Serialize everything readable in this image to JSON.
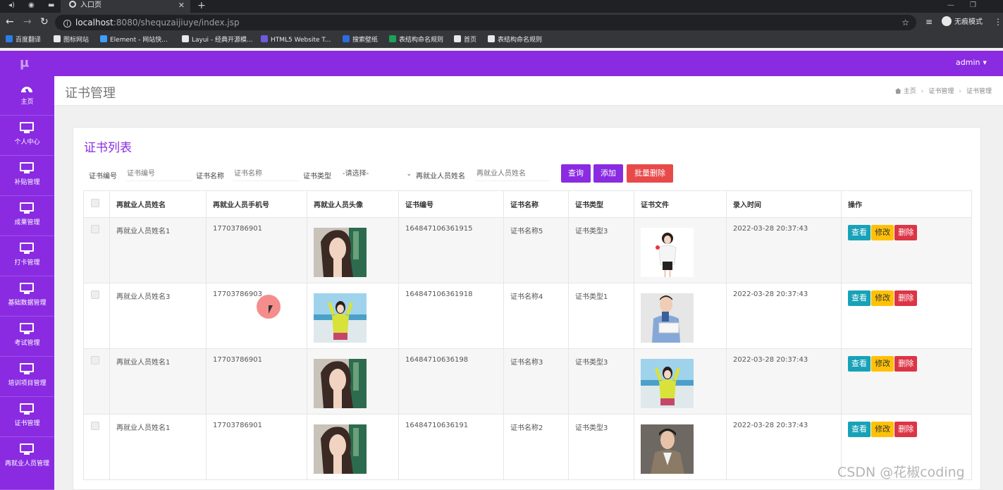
{
  "browser": {
    "tab_title": "入口页",
    "url_host": "localhost",
    "url_path": ":8080/shequzaijiuye/index.jsp",
    "incognito_label": "无痕模式",
    "bookmarks": [
      {
        "label": "百度翻译",
        "color": "#2b7de9"
      },
      {
        "label": "图标网站",
        "color": "#e8e8e8"
      },
      {
        "label": "Element - 网站快...",
        "color": "#409eff"
      },
      {
        "label": "Layui - 经典开源模...",
        "color": "#e8e8e8"
      },
      {
        "label": "HTML5 Website T...",
        "color": "#6b5be0"
      },
      {
        "label": "搜索壁纸",
        "color": "#2d6cdf"
      },
      {
        "label": "表结构命名规则",
        "color": "#1aa35a"
      },
      {
        "label": "首页",
        "color": "#e8e8e8"
      },
      {
        "label": "表结构命名规则",
        "color": "#e8e8e8"
      }
    ]
  },
  "header": {
    "logo": "μ",
    "user": "admin"
  },
  "sidebar": {
    "items": [
      {
        "label": "主页",
        "icon": "dashboard-icon"
      },
      {
        "label": "个人中心",
        "icon": "monitor-icon"
      },
      {
        "label": "补贴管理",
        "icon": "monitor-icon"
      },
      {
        "label": "成果管理",
        "icon": "monitor-icon"
      },
      {
        "label": "打卡管理",
        "icon": "monitor-icon"
      },
      {
        "label": "基础数据管理",
        "icon": "monitor-icon"
      },
      {
        "label": "考试管理",
        "icon": "monitor-icon"
      },
      {
        "label": "培训项目管理",
        "icon": "monitor-icon"
      },
      {
        "label": "证书管理",
        "icon": "monitor-icon"
      },
      {
        "label": "再就业人员管理",
        "icon": "monitor-icon"
      }
    ]
  },
  "page": {
    "title": "证书管理",
    "breadcrumb": [
      "主页",
      "证书管理",
      "证书管理"
    ]
  },
  "card": {
    "title": "证书列表"
  },
  "filters": {
    "cert_no_label": "证书编号",
    "cert_no_placeholder": "证书编号",
    "cert_name_label": "证书名称",
    "cert_name_placeholder": "证书名称",
    "cert_type_label": "证书类型",
    "cert_type_value": "-请选择-",
    "person_label": "再就业人员姓名",
    "person_placeholder": "再就业人员姓名"
  },
  "buttons": {
    "search": "查询",
    "add": "添加",
    "batch_delete": "批量删除",
    "search_color": "#8a2be2",
    "add_color": "#8a2be2",
    "batch_delete_color": "#e84a4a"
  },
  "table": {
    "headers": [
      "再就业人员姓名",
      "再就业人员手机号",
      "再就业人员头像",
      "证书编号",
      "证书名称",
      "证书类型",
      "证书文件",
      "录入时间",
      "操作"
    ],
    "actions": {
      "view": "查看",
      "edit": "修改",
      "delete": "删除"
    },
    "rows": [
      {
        "name": "再就业人员姓名1",
        "phone": "17703786901",
        "avatar": "portrait-woman-image",
        "cert_no": "164847106361915",
        "cert_name": "证书名称5",
        "cert_type": "证书类型3",
        "file": "woman-white-shirt-image",
        "time": "2022-03-28 20:37:43"
      },
      {
        "name": "再就业人员姓名3",
        "phone": "17703786903",
        "avatar": "yellow-sweater-woman-image",
        "cert_no": "164847106361918",
        "cert_name": "证书名称4",
        "cert_type": "证书类型1",
        "file": "man-reading-book-image",
        "time": "2022-03-28 20:37:43"
      },
      {
        "name": "再就业人员姓名1",
        "phone": "17703786901",
        "avatar": "portrait-woman-image",
        "cert_no": "16484710636198",
        "cert_name": "证书名称3",
        "cert_type": "证书类型3",
        "file": "yellow-sweater-woman-image",
        "time": "2022-03-28 20:37:43"
      },
      {
        "name": "再就业人员姓名1",
        "phone": "17703786901",
        "avatar": "portrait-woman-image",
        "cert_no": "16484710636191",
        "cert_name": "证书名称2",
        "cert_type": "证书类型3",
        "file": "man-coat-image",
        "time": "2022-03-28 20:37:43"
      }
    ]
  },
  "watermark": "CSDN @花椒coding"
}
